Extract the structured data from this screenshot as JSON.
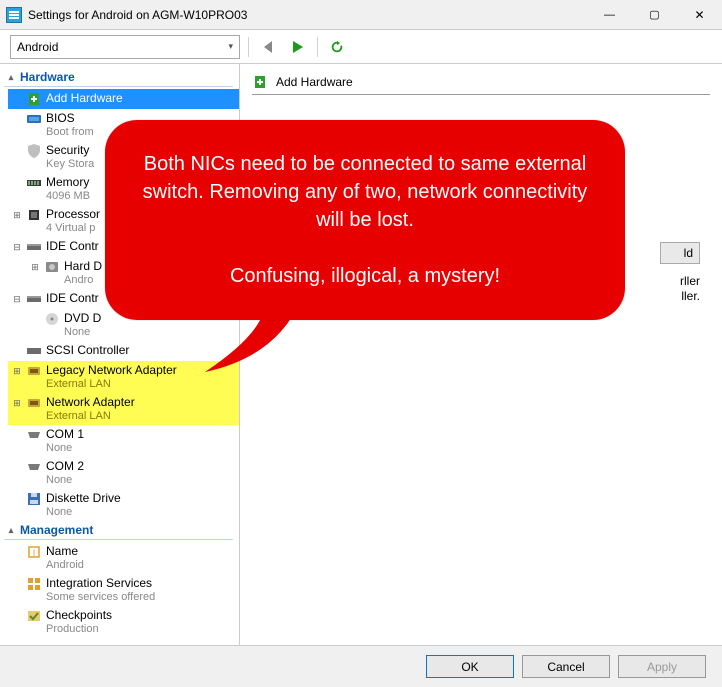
{
  "window": {
    "title": "Settings for Android on AGM-W10PRO03",
    "min": "—",
    "max": "▢",
    "close": "✕"
  },
  "toolbar": {
    "vm_name": "Android"
  },
  "sidebar": {
    "cat_hardware": "Hardware",
    "cat_management": "Management",
    "expander_open": "⊟",
    "expander_closed": "⊞",
    "items": [
      {
        "label": "Add Hardware",
        "sub": ""
      },
      {
        "label": "BIOS",
        "sub": "Boot from"
      },
      {
        "label": "Security",
        "sub": "Key Stora"
      },
      {
        "label": "Memory",
        "sub": "4096 MB"
      },
      {
        "label": "Processor",
        "sub": "4 Virtual p"
      },
      {
        "label": "IDE Contr",
        "sub": ""
      },
      {
        "label": "Hard D",
        "sub": "Andro"
      },
      {
        "label": "IDE Contr",
        "sub": ""
      },
      {
        "label": "DVD D",
        "sub": "None"
      },
      {
        "label": "SCSI Controller",
        "sub": ""
      },
      {
        "label": "Legacy Network Adapter",
        "sub": "External LAN"
      },
      {
        "label": "Network Adapter",
        "sub": "External LAN"
      },
      {
        "label": "COM 1",
        "sub": "None"
      },
      {
        "label": "COM 2",
        "sub": "None"
      },
      {
        "label": "Diskette Drive",
        "sub": "None"
      },
      {
        "label": "Name",
        "sub": "Android"
      },
      {
        "label": "Integration Services",
        "sub": "Some services offered"
      },
      {
        "label": "Checkpoints",
        "sub": "Production"
      }
    ]
  },
  "right": {
    "header": "Add Hardware",
    "hidden_line1": "rller",
    "hidden_line2": "ller.",
    "hidden_btn": "ld"
  },
  "buttons": {
    "ok": "OK",
    "cancel": "Cancel",
    "apply": "Apply"
  },
  "callout": {
    "line1": "Both NICs need to be connected to same external switch. Removing any of two, network connectivity will be lost.",
    "line2": "Confusing, illogical, a mystery!"
  }
}
